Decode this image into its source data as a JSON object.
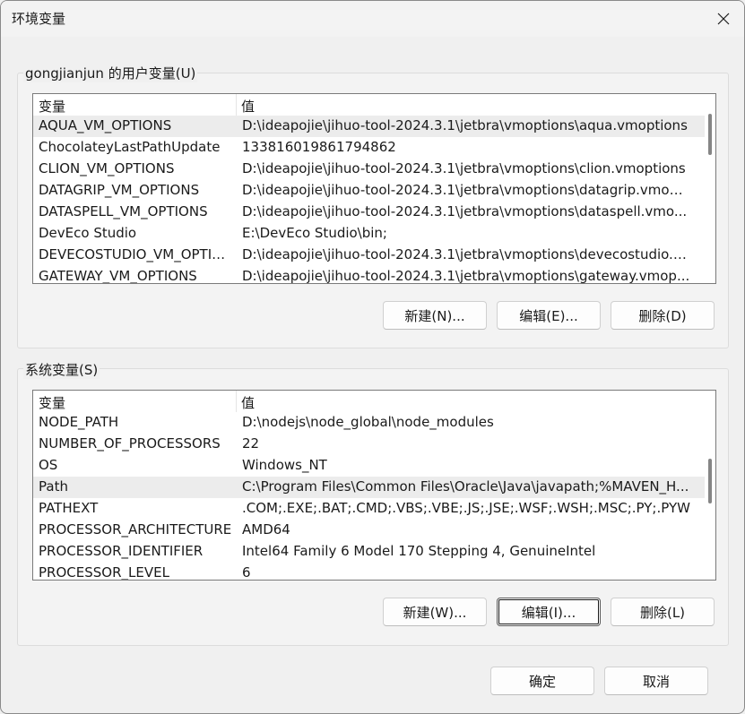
{
  "window": {
    "title": "环境变量",
    "close_icon": "close-icon"
  },
  "user_vars": {
    "label": "gongjianjun 的用户变量(U)",
    "columns": {
      "name": "变量",
      "value": "值"
    },
    "rows": [
      {
        "name": "AQUA_VM_OPTIONS",
        "value": "D:\\ideapojie\\jihuo-tool-2024.3.1\\jetbra\\vmoptions\\aqua.vmoptions",
        "selected": true
      },
      {
        "name": "ChocolateyLastPathUpdate",
        "value": "133816019861794862"
      },
      {
        "name": "CLION_VM_OPTIONS",
        "value": "D:\\ideapojie\\jihuo-tool-2024.3.1\\jetbra\\vmoptions\\clion.vmoptions"
      },
      {
        "name": "DATAGRIP_VM_OPTIONS",
        "value": "D:\\ideapojie\\jihuo-tool-2024.3.1\\jetbra\\vmoptions\\datagrip.vmop..."
      },
      {
        "name": "DATASPELL_VM_OPTIONS",
        "value": "D:\\ideapojie\\jihuo-tool-2024.3.1\\jetbra\\vmoptions\\dataspell.vmo..."
      },
      {
        "name": "DevEco Studio",
        "value": "E:\\DevEco Studio\\bin;"
      },
      {
        "name": "DEVECOSTUDIO_VM_OPTIO...",
        "value": "D:\\ideapojie\\jihuo-tool-2024.3.1\\jetbra\\vmoptions\\devecostudio.v..."
      },
      {
        "name": "GATEWAY_VM_OPTIONS",
        "value": "D:\\ideapojie\\jihuo-tool-2024.3.1\\jetbra\\vmoptions\\gateway.vmop..."
      }
    ],
    "buttons": {
      "new": "新建(N)...",
      "edit": "编辑(E)...",
      "delete": "删除(D)"
    }
  },
  "system_vars": {
    "label": "系统变量(S)",
    "columns": {
      "name": "变量",
      "value": "值"
    },
    "rows": [
      {
        "name": "NODE_PATH",
        "value": "D:\\nodejs\\node_global\\node_modules"
      },
      {
        "name": "NUMBER_OF_PROCESSORS",
        "value": "22"
      },
      {
        "name": "OS",
        "value": "Windows_NT"
      },
      {
        "name": "Path",
        "value": "C:\\Program Files\\Common Files\\Oracle\\Java\\javapath;%MAVEN_H...",
        "selected": true
      },
      {
        "name": "PATHEXT",
        "value": ".COM;.EXE;.BAT;.CMD;.VBS;.VBE;.JS;.JSE;.WSF;.WSH;.MSC;.PY;.PYW"
      },
      {
        "name": "PROCESSOR_ARCHITECTURE",
        "value": "AMD64"
      },
      {
        "name": "PROCESSOR_IDENTIFIER",
        "value": "Intel64 Family 6 Model 170 Stepping 4, GenuineIntel"
      },
      {
        "name": "PROCESSOR_LEVEL",
        "value": "6"
      }
    ],
    "buttons": {
      "new": "新建(W)...",
      "edit": "编辑(I)...",
      "delete": "删除(L)"
    }
  },
  "footer": {
    "ok": "确定",
    "cancel": "取消"
  }
}
